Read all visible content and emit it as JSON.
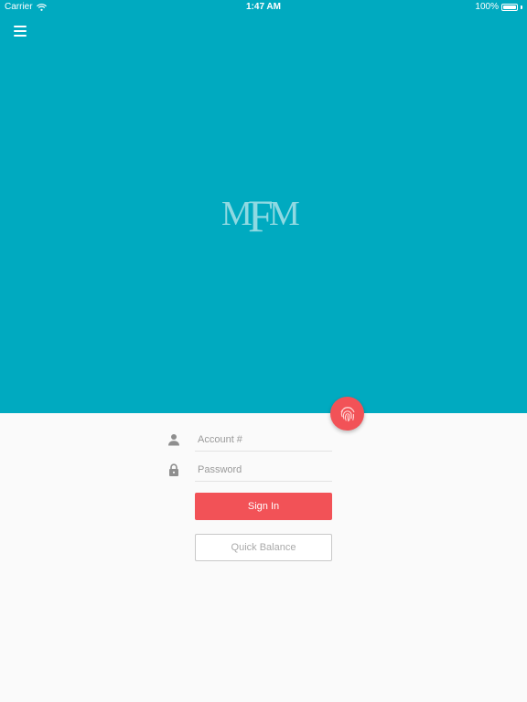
{
  "status_bar": {
    "carrier": "Carrier",
    "time": "1:47 AM",
    "battery": "100%",
    "battery_level": 1.0
  },
  "header": {
    "menu_icon": "hamburger-menu-icon",
    "logo_letters": [
      "M",
      "F",
      "M"
    ]
  },
  "login": {
    "fingerprint_icon": "fingerprint-icon",
    "account_icon": "person-icon",
    "account_placeholder": "Account #",
    "account_value": "",
    "password_icon": "lock-icon",
    "password_placeholder": "Password",
    "password_value": "",
    "sign_in_label": "Sign In",
    "quick_balance_label": "Quick Balance"
  },
  "colors": {
    "brand_teal": "#00aac0",
    "accent_red": "#f25257",
    "logo_tint": "#8fd9e2",
    "background": "#fafafa"
  }
}
